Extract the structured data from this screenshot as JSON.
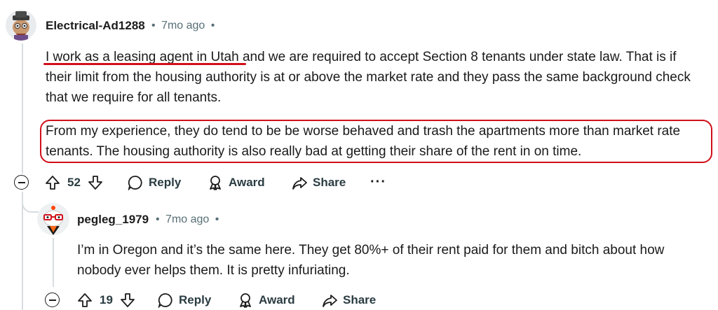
{
  "colors": {
    "accent_red": "#d0101a",
    "meta": "#576f76",
    "text": "#1a1a1b"
  },
  "comments": [
    {
      "username": "Electrical-Ad1288",
      "time": "7mo ago",
      "paragraphs": [
        {
          "highlight": "I work as a leasing agent in Utah",
          "rest": " and we are required to accept Section 8 tenants under state law. That is if their limit from the housing authority is at or above the market rate and they pass the same background check that we require for all tenants."
        },
        {
          "text": "From my experience, they do tend to be be worse behaved and trash the apartments more than market rate tenants. The housing authority is also really bad at getting their share of the rent in on time."
        }
      ],
      "votes": "52",
      "reply_label": "Reply",
      "award_label": "Award",
      "share_label": "Share",
      "more_label": "···"
    },
    {
      "username": "pegleg_1979",
      "time": "7mo ago",
      "paragraphs": [
        {
          "text": "I’m in Oregon and it’s the same here. They get 80%+ of their rent paid for them and bitch about how nobody ever helps them. It is pretty infuriating."
        }
      ],
      "votes": "19",
      "reply_label": "Reply",
      "award_label": "Award",
      "share_label": "Share"
    }
  ]
}
